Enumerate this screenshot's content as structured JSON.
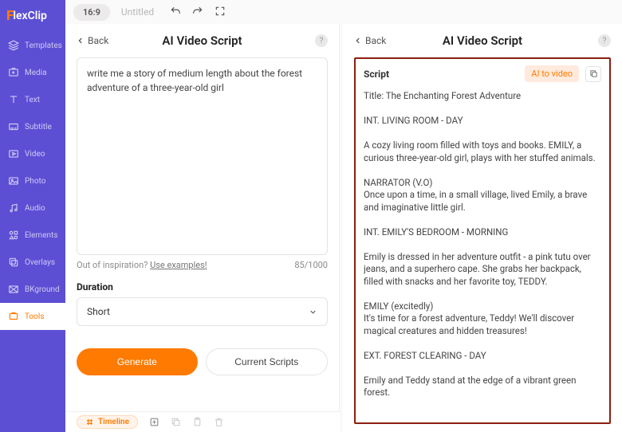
{
  "logo": {
    "prefix": "F",
    "rest": "lexClip"
  },
  "topbar": {
    "aspect": "16:9",
    "doc_title": "Untitled"
  },
  "sidebar": {
    "items": [
      {
        "label": "Templates"
      },
      {
        "label": "Media"
      },
      {
        "label": "Text"
      },
      {
        "label": "Subtitle"
      },
      {
        "label": "Video"
      },
      {
        "label": "Photo"
      },
      {
        "label": "Audio"
      },
      {
        "label": "Elements"
      },
      {
        "label": "Overlays"
      },
      {
        "label": "BKground"
      },
      {
        "label": "Tools"
      }
    ]
  },
  "panel_left": {
    "back_label": "Back",
    "title": "AI Video Script",
    "prompt_value": "write me a story of medium length about the forest adventure of a three-year-old girl",
    "inspiration_prefix": "Out of inspiration? ",
    "inspiration_link": "Use examples!",
    "counter": "85/1000",
    "duration_label": "Duration",
    "duration_value": "Short",
    "generate_label": "Generate",
    "current_scripts_label": "Current Scripts"
  },
  "panel_right": {
    "back_label": "Back",
    "title": "AI Video Script",
    "script_heading": "Script",
    "ai_to_video_label": "AI to video",
    "script_text": "Title: The Enchanting Forest Adventure\n\nINT. LIVING ROOM - DAY\n\nA cozy living room filled with toys and books. EMILY, a curious three-year-old girl, plays with her stuffed animals.\n\nNARRATOR (V.O)\nOnce upon a time, in a small village, lived Emily, a brave and imaginative little girl.\n\nINT. EMILY'S BEDROOM - MORNING\n\nEmily is dressed in her adventure outfit - a pink tutu over jeans, and a superhero cape. She grabs her backpack, filled with snacks and her favorite toy, TEDDY.\n\nEMILY (excitedly)\nIt's time for a forest adventure, Teddy! We'll discover magical creatures and hidden treasures!\n\nEXT. FOREST CLEARING - DAY\n\nEmily and Teddy stand at the edge of a vibrant green forest."
  },
  "bottom": {
    "timeline_label": "Timeline"
  }
}
